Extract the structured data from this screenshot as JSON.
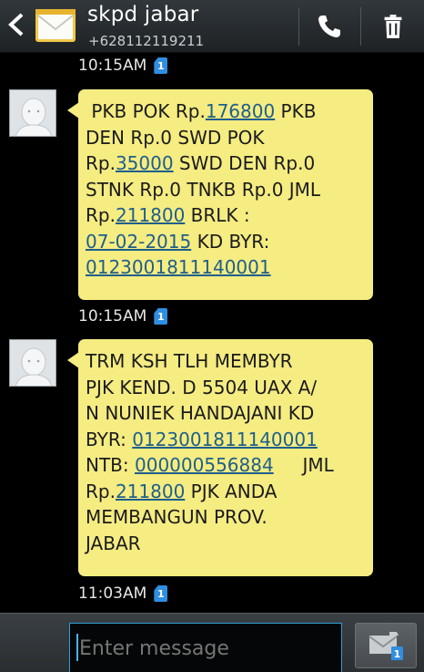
{
  "header": {
    "contact_name": "skpd jabar",
    "contact_number": "+628112119211"
  },
  "messages": [
    {
      "time_above": "10:15AM",
      "sim": "1",
      "parts": [
        {
          "t": " PKB POK Rp."
        },
        {
          "t": "176800",
          "link": true
        },
        {
          "t": " PKB\nDEN Rp.0 SWD POK\nRp."
        },
        {
          "t": "35000",
          "link": true
        },
        {
          "t": " SWD DEN Rp.0\nSTNK Rp.0 TNKB Rp.0 JML\nRp."
        },
        {
          "t": "211800",
          "link": true
        },
        {
          "t": " BRLK :\n"
        },
        {
          "t": "07-02-2015",
          "link": true
        },
        {
          "t": " KD BYR:\n"
        },
        {
          "t": "0123001811140001",
          "link": true
        }
      ]
    },
    {
      "time_above": "10:15AM",
      "sim": "1",
      "parts": [
        {
          "t": "TRM KSH TLH MEMBYR\nPJK KEND. D 5504 UAX A/\nN NUNIEK HANDAJANI KD\nBYR: "
        },
        {
          "t": "0123001811140001",
          "link": true
        },
        {
          "t": "\nNTB: "
        },
        {
          "t": "000000556884",
          "link": true
        },
        {
          "t": "     JML\nRp."
        },
        {
          "t": "211800",
          "link": true
        },
        {
          "t": " PJK ANDA\nMEMBANGUN PROV.\nJABAR"
        }
      ]
    }
  ],
  "last_time": "11:03AM",
  "last_sim": "1",
  "composer": {
    "placeholder": "Enter message",
    "send_sim": "1"
  },
  "colors": {
    "bubble": "#f5ec82",
    "link": "#1f5f8b",
    "accent": "#2f9fd8"
  }
}
